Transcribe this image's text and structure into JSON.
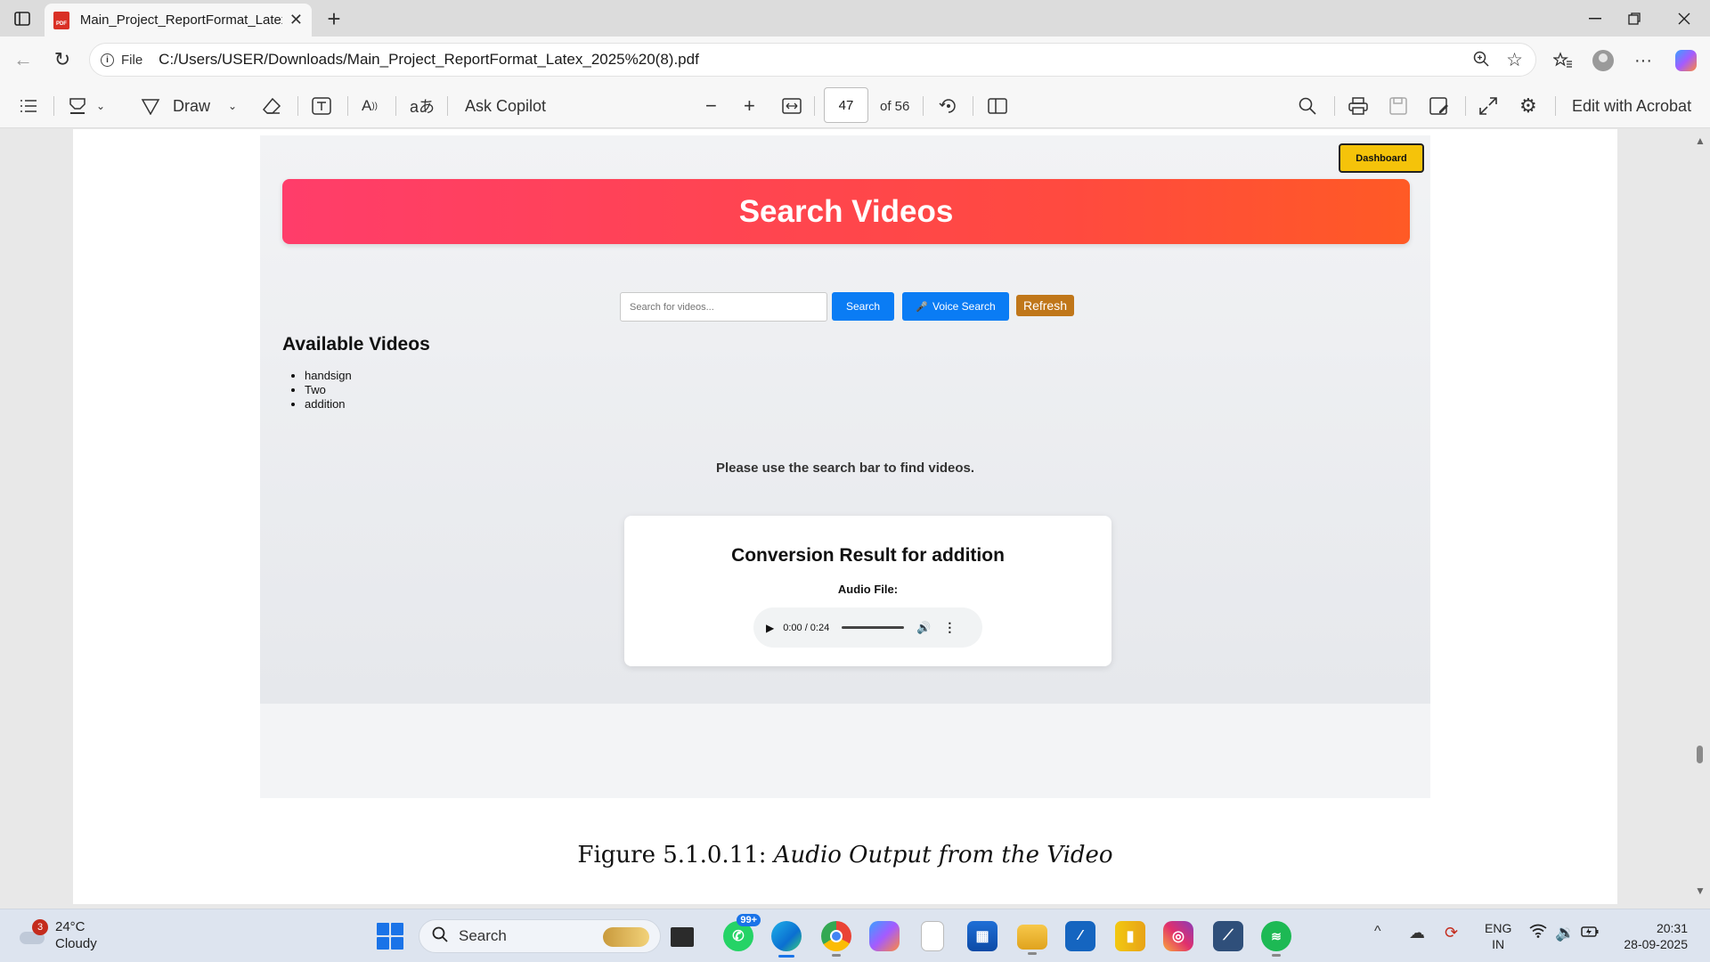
{
  "browser": {
    "tab_title": "Main_Project_ReportFormat_Latex_2025(8).pdf",
    "tab_icon_text": "PDF",
    "new_tab": "+",
    "close_tab": "✕",
    "url_label": "File",
    "url": "C:/Users/USER/Downloads/Main_Project_ReportFormat_Latex_2025%20(8).pdf"
  },
  "pdf_toolbar": {
    "draw_label": "Draw",
    "ask_copilot": "Ask Copilot",
    "page_current": "47",
    "page_total": "of 56",
    "edit_acrobat": "Edit with Acrobat"
  },
  "app_screenshot": {
    "dashboard": "Dashboard",
    "hero_title": "Search Videos",
    "search_placeholder": "Search for videos...",
    "search_btn": "Search",
    "voice_btn": "Voice Search",
    "refresh_btn": "Refresh",
    "available_heading": "Available Videos",
    "videos": [
      "handsign",
      "Two",
      "addition"
    ],
    "hint": "Please use the search bar to find videos.",
    "result_title": "Conversion Result for addition",
    "audio_label": "Audio File:",
    "audio_time": "0:00 / 0:24"
  },
  "caption": {
    "prefix": "Figure 5.1.0.11:",
    "text": "Audio Output from the Video"
  },
  "taskbar": {
    "weather_badge": "3",
    "temperature": "24°C",
    "condition": "Cloudy",
    "search_label": "Search",
    "whatsapp_badge": "99+",
    "lang_top": "ENG",
    "lang_bottom": "IN",
    "time": "20:31",
    "date": "28-09-2025"
  }
}
